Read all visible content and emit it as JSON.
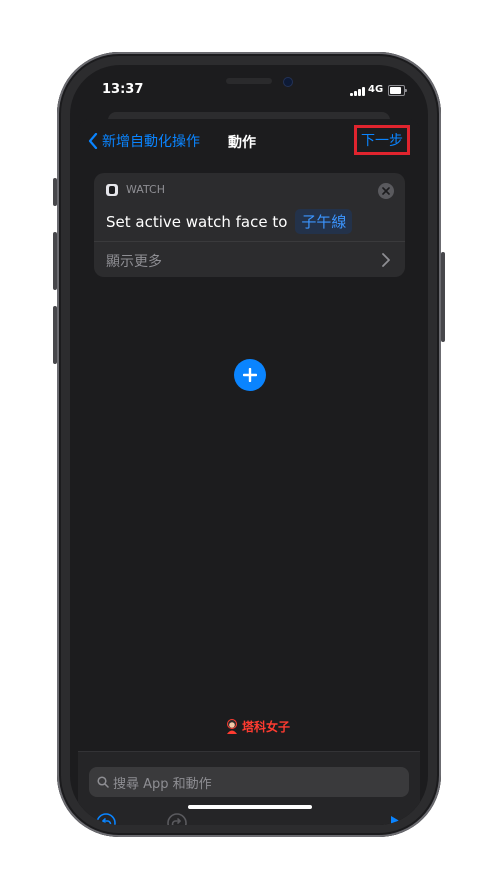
{
  "status_bar": {
    "time": "13:37",
    "network": "4G"
  },
  "nav": {
    "back_label": "新增自動化操作",
    "title": "動作",
    "next_label": "下一步"
  },
  "action_card": {
    "app_name": "WATCH",
    "action_text": "Set active watch face to",
    "parameter_value": "子午線",
    "show_more_label": "顯示更多"
  },
  "watermark": {
    "text": "塔科女子"
  },
  "search": {
    "placeholder": "搜尋 App 和動作"
  },
  "colors": {
    "accent": "#0a84ff",
    "highlight_border": "#e0242e",
    "background": "#1c1c1e",
    "card": "#2c2c2e"
  },
  "icons": [
    "chevron-left-icon",
    "watch-app-icon",
    "close-icon",
    "chevron-right-icon",
    "plus-icon",
    "search-icon",
    "undo-icon",
    "redo-icon",
    "play-icon"
  ]
}
